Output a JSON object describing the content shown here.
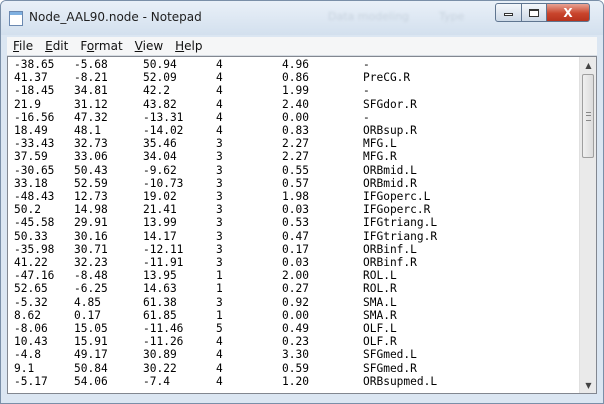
{
  "window": {
    "title": "Node_AAL90.node - Notepad",
    "ghost_text_1": "Data modeling",
    "ghost_text_2": "Type",
    "minimize_icon": "minimize-icon",
    "maximize_icon": "maximize-icon",
    "close_label": "X"
  },
  "menu": [
    {
      "label": "File",
      "mnemonic": "F",
      "rest": "ile"
    },
    {
      "label": "Edit",
      "mnemonic": "E",
      "rest": "dit"
    },
    {
      "label": "Format",
      "mnemonic": "",
      "rest": "Format",
      "pre": "F",
      "mn2": "o",
      "post": "rmat"
    },
    {
      "label": "View",
      "mnemonic": "V",
      "rest": "iew"
    },
    {
      "label": "Help",
      "mnemonic": "H",
      "rest": "elp"
    }
  ],
  "rows": [
    [
      "-38.65",
      "-5.68",
      "50.94",
      "4",
      "4.96",
      "-"
    ],
    [
      "41.37",
      "-8.21",
      "52.09",
      "4",
      "0.86",
      "PreCG.R"
    ],
    [
      "-18.45",
      "34.81",
      "42.2",
      "4",
      "1.99",
      "-"
    ],
    [
      "21.9",
      "31.12",
      "43.82",
      "4",
      "2.40",
      "SFGdor.R"
    ],
    [
      "-16.56",
      "47.32",
      "-13.31",
      "4",
      "0.00",
      "-"
    ],
    [
      "18.49",
      "48.1",
      "-14.02",
      "4",
      "0.83",
      "ORBsup.R"
    ],
    [
      "-33.43",
      "32.73",
      "35.46",
      "3",
      "2.27",
      "MFG.L"
    ],
    [
      "37.59",
      "33.06",
      "34.04",
      "3",
      "2.27",
      "MFG.R"
    ],
    [
      "-30.65",
      "50.43",
      "-9.62",
      "3",
      "0.55",
      "ORBmid.L"
    ],
    [
      "33.18",
      "52.59",
      "-10.73",
      "3",
      "0.57",
      "ORBmid.R"
    ],
    [
      "-48.43",
      "12.73",
      "19.02",
      "3",
      "1.98",
      "IFGoperc.L"
    ],
    [
      "50.2",
      "14.98",
      "21.41",
      "3",
      "0.03",
      "IFGoperc.R"
    ],
    [
      "-45.58",
      "29.91",
      "13.99",
      "3",
      "0.53",
      "IFGtriang.L"
    ],
    [
      "50.33",
      "30.16",
      "14.17",
      "3",
      "0.47",
      "IFGtriang.R"
    ],
    [
      "-35.98",
      "30.71",
      "-12.11",
      "3",
      "0.17",
      "ORBinf.L"
    ],
    [
      "41.22",
      "32.23",
      "-11.91",
      "3",
      "0.03",
      "ORBinf.R"
    ],
    [
      "-47.16",
      "-8.48",
      "13.95",
      "1",
      "2.00",
      "ROL.L"
    ],
    [
      "52.65",
      "-6.25",
      "14.63",
      "1",
      "0.27",
      "ROL.R"
    ],
    [
      "-5.32",
      "4.85",
      "61.38",
      "3",
      "0.92",
      "SMA.L"
    ],
    [
      "8.62",
      "0.17",
      "61.85",
      "1",
      "0.00",
      "SMA.R"
    ],
    [
      "-8.06",
      "15.05",
      "-11.46",
      "5",
      "0.49",
      "OLF.L"
    ],
    [
      "10.43",
      "15.91",
      "-11.26",
      "4",
      "0.23",
      "OLF.R"
    ],
    [
      "-4.8",
      "49.17",
      "30.89",
      "4",
      "3.30",
      "SFGmed.L"
    ],
    [
      "9.1",
      "50.84",
      "30.22",
      "4",
      "0.59",
      "SFGmed.R"
    ],
    [
      "-5.17",
      "54.06",
      "-7.4",
      "4",
      "1.20",
      "ORBsupmed.L"
    ]
  ],
  "scrollbar": {
    "up_icon": "scroll-up-icon",
    "down_icon": "scroll-down-icon"
  }
}
